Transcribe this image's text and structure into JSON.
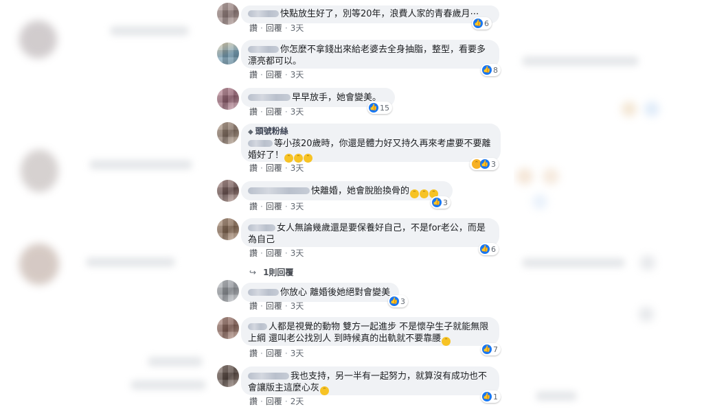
{
  "actions": {
    "like": "讚",
    "reply": "回覆",
    "sep": "·"
  },
  "comments": [
    {
      "text": "快點放生好了，別等20年，浪費人家的青春歲月⋯",
      "time": "3天",
      "count": "6"
    },
    {
      "text": "你怎麼不拿錢出來給老婆去全身抽脂，整型，看要多漂亮都可以。",
      "time": "3天",
      "count": "8"
    },
    {
      "text": "早早放手，她會變美。",
      "time": "3天",
      "count": "15"
    },
    {
      "badge": "頭號粉絲",
      "text": "等小孩20歲時，你還是體力好又持久再來考慮要不要離婚好了！",
      "time": "3天",
      "count": "3"
    },
    {
      "text": "快離婚，她會脫胎換骨的",
      "time": "3天",
      "count": "3"
    },
    {
      "text": "女人無論幾歲還是要保養好自己，不是for老公，而是為自己",
      "time": "3天",
      "count": "6"
    },
    {
      "text": "你放心 離婚後她絕對會變美",
      "time": "3天",
      "count": "3"
    },
    {
      "text": "人都是視覺的動物 雙方一起進步 不是懷孕生子就能無限上綱 還叫老公找別人 到時候真的出軌就不要靠腰",
      "time": "3天",
      "count": "7"
    },
    {
      "text": "我也支持，另一半有一起努力，就算沒有成功也不會讓版主這麼心灰",
      "time": "2天",
      "count": "1"
    }
  ],
  "reply_link": "1則回覆",
  "colors": {
    "like_blue": "#1877f2",
    "bubble_bg": "#f0f2f5",
    "text": "#1c1e21",
    "meta": "#606770"
  }
}
